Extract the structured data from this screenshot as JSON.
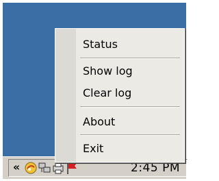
{
  "menu": {
    "items": [
      {
        "label": "Status"
      },
      {
        "label": "Show log"
      },
      {
        "label": "Clear log"
      },
      {
        "label": "About"
      },
      {
        "label": "Exit"
      }
    ]
  },
  "taskbar": {
    "chevron": "«",
    "clock": "2:45 PM",
    "tray_icons": [
      "app-tray-icon",
      "network-tray-icon",
      "printer-tray-icon",
      "flag-tray-icon"
    ]
  },
  "colors": {
    "desktop": "#3a6ea5",
    "taskbar": "#d4d0c8",
    "menu_bg": "#eceae4",
    "flag_red": "#d42020"
  }
}
